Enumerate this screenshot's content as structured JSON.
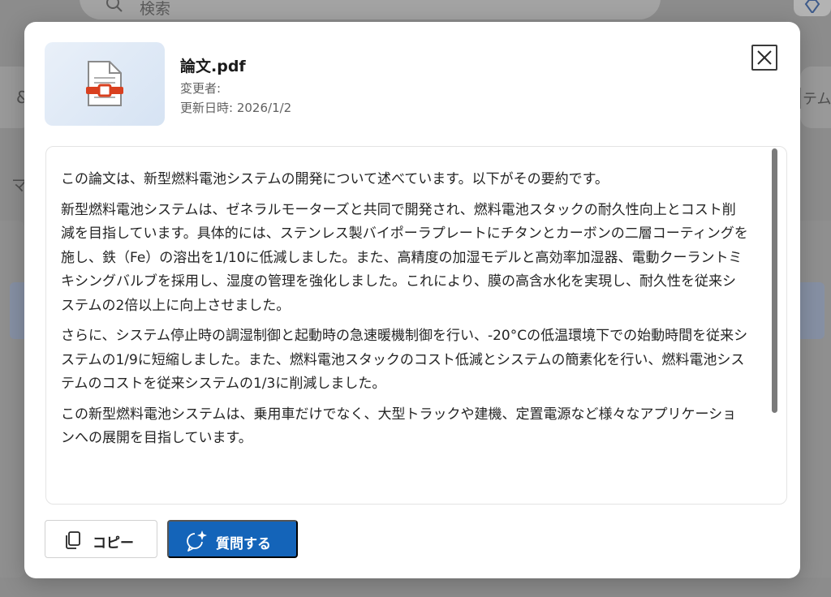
{
  "background": {
    "search_placeholder": "検索",
    "left_label": "マ",
    "left_card_glyph": "&",
    "right_card_text": "テム"
  },
  "file": {
    "name": "論文.pdf",
    "editor_label": "変更者:",
    "updated_label": "更新日時:",
    "updated_value": "2026/1/2"
  },
  "summary": {
    "paragraphs": [
      "この論文は、新型燃料電池システムの開発について述べています。以下がその要約です。",
      "新型燃料電池システムは、ゼネラルモーターズと共同で開発され、燃料電池スタックの耐久性向上とコスト削減を目指しています。具体的には、ステンレス製バイポーラプレートにチタンとカーボンの二層コーティングを施し、鉄（Fe）の溶出を1/10に低減しました。また、高精度の加湿モデルと高効率加湿器、電動クーラントミキシングバルブを採用し、湿度の管理を強化しました。これにより、膜の高含水化を実現し、耐久性を従来システムの2倍以上に向上させました。",
      "さらに、システム停止時の調湿制御と起動時の急速暖機制御を行い、-20°Cの低温環境下での始動時間を従来システムの1/9に短縮しました。また、燃料電池スタックのコスト低減とシステムの簡素化を行い、燃料電池システムのコストを従来システムの1/3に削減しました。",
      "この新型燃料電池システムは、乗用車だけでなく、大型トラックや建機、定置電源など様々なアプリケーションへの展開を目指しています。"
    ]
  },
  "actions": {
    "copy_label": "コピー",
    "ask_label": "質問する"
  },
  "colors": {
    "primary": "#1464b9",
    "overlay": "#8c8c8c",
    "pdf_icon_accent": "#d9401f"
  },
  "icons": {
    "close": "close-icon",
    "copy": "copy-icon",
    "ask": "sparkle-chat-icon",
    "file": "pdf-file-icon",
    "search": "search-icon",
    "premium": "diamond-icon"
  }
}
